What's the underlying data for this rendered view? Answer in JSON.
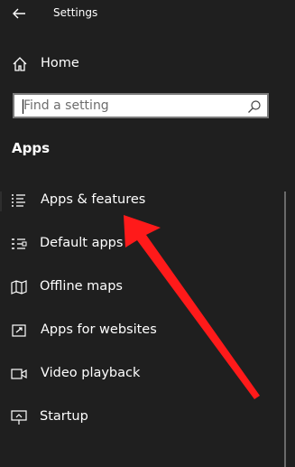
{
  "window": {
    "title": "Settings"
  },
  "home": {
    "label": "Home",
    "icon": "home-icon"
  },
  "search": {
    "placeholder": "Find a setting",
    "icon": "search-icon"
  },
  "section": {
    "title": "Apps"
  },
  "nav": {
    "items": [
      {
        "label": "Apps & features",
        "icon": "apps-features-icon",
        "selected": true
      },
      {
        "label": "Default apps",
        "icon": "default-apps-icon"
      },
      {
        "label": "Offline maps",
        "icon": "map-icon"
      },
      {
        "label": "Apps for websites",
        "icon": "open-external-icon"
      },
      {
        "label": "Video playback",
        "icon": "video-icon"
      },
      {
        "label": "Startup",
        "icon": "startup-icon"
      }
    ]
  },
  "colors": {
    "background": "#1f1f1f",
    "annotation_arrow": "#ff1a1a"
  }
}
